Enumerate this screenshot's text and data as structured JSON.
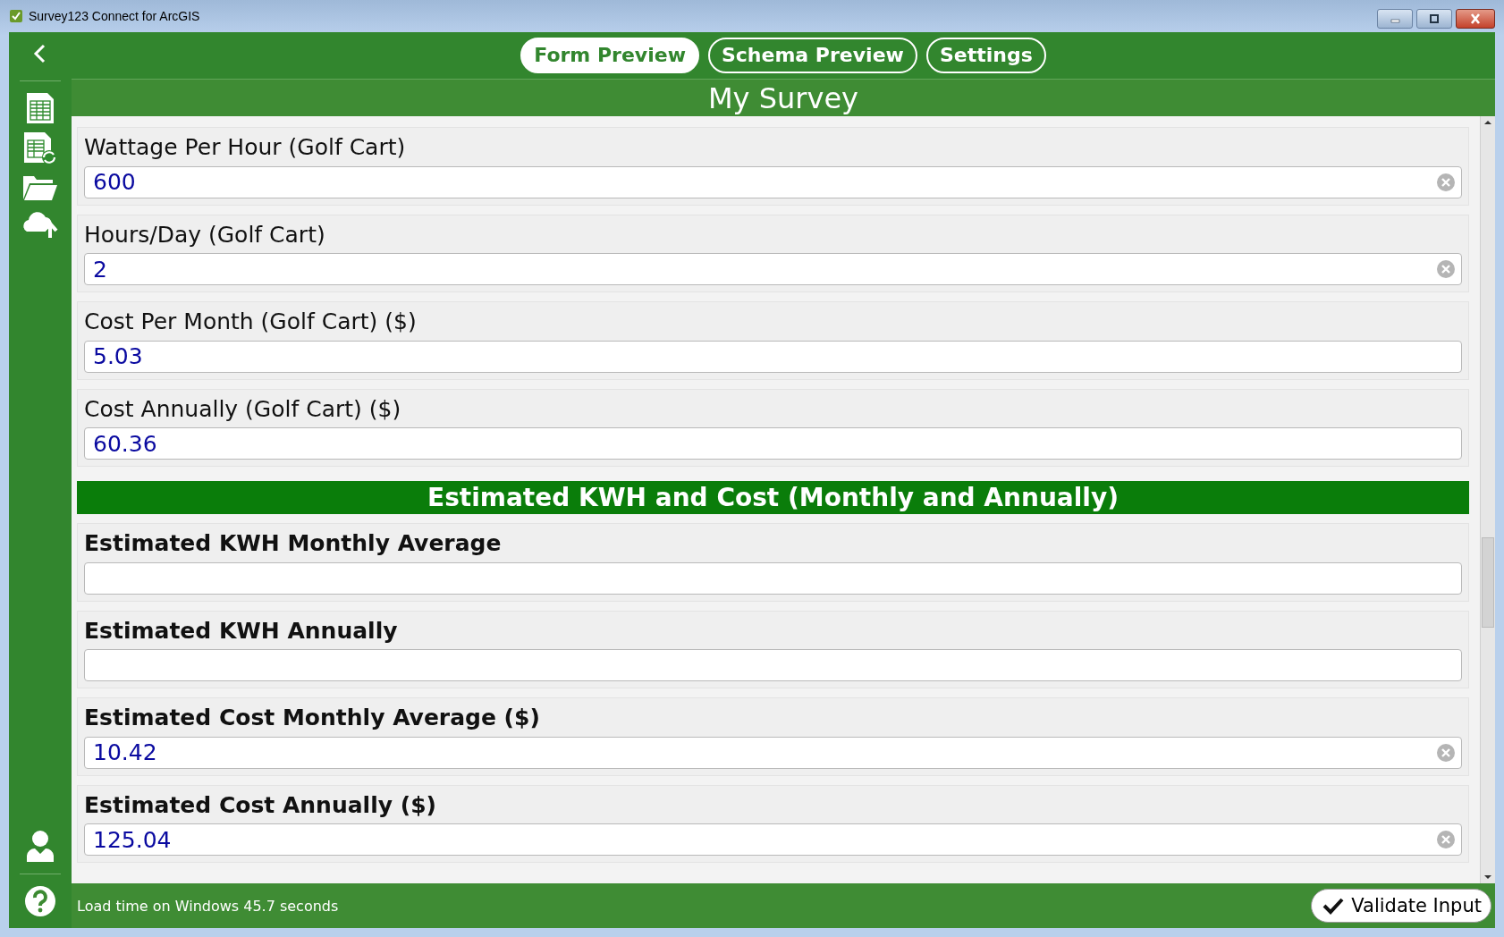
{
  "window": {
    "title": "Survey123 Connect for ArcGIS"
  },
  "tabs": [
    {
      "label": "Form Preview",
      "selected": true
    },
    {
      "label": "Schema Preview",
      "selected": false
    },
    {
      "label": "Settings",
      "selected": false
    }
  ],
  "form_title": "My Survey",
  "groups": [
    {
      "questions": [
        {
          "label": "Wattage Per Hour (Golf Cart)",
          "value": "600",
          "clearable": true,
          "bold": false
        },
        {
          "label": "Hours/Day (Golf Cart)",
          "value": "2",
          "clearable": true,
          "bold": false
        },
        {
          "label": "Cost Per Month (Golf Cart) ($)",
          "value": "5.03",
          "clearable": false,
          "bold": false
        },
        {
          "label": "Cost Annually (Golf Cart) ($)",
          "value": "60.36",
          "clearable": false,
          "bold": false
        }
      ]
    },
    {
      "header": "Estimated KWH and Cost (Monthly and Annually)",
      "questions": [
        {
          "label": "Estimated KWH Monthly Average",
          "clearable": false,
          "bold": true
        },
        {
          "label": "Estimated KWH Annually",
          "clearable": false,
          "bold": true
        },
        {
          "label": "Estimated Cost Monthly Average ($)",
          "value": "10.42",
          "clearable": true,
          "bold": true
        },
        {
          "label": "Estimated Cost Annually ($)",
          "value": "125.04",
          "clearable": true,
          "bold": true
        }
      ]
    }
  ],
  "status": "Load time on Windows 45.7 seconds",
  "validate_button": "Validate Input"
}
